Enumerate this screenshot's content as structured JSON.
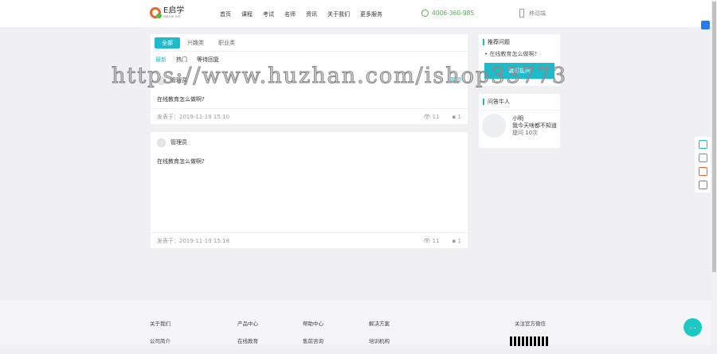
{
  "header": {
    "logo_text": "E启学",
    "logo_sub": "eqixue.net",
    "nav": [
      "首页",
      "课程",
      "考试",
      "名师",
      "资讯",
      "关于我们",
      "更多服务"
    ],
    "phone": "4006-360-985",
    "app": "移动端"
  },
  "tabs": {
    "categories": [
      "全部",
      "兴趣类",
      "职业类"
    ],
    "sorts": [
      "最新",
      "热门",
      "等待回复"
    ]
  },
  "posts": [
    {
      "author": "管理员",
      "tag": "置顶",
      "title": "在线教育怎么做啊?",
      "time": "发表于：2019-11-19 15:10",
      "views": "11",
      "comments": "1"
    },
    {
      "author": "管理员",
      "title": "在线教育怎么做啊?",
      "time": "发表于：2019-11-19 15:18",
      "views": "11",
      "comments": "1"
    }
  ],
  "sidebar": {
    "recommend_title": "推荐问题",
    "recommend_item": "在线教育怎么做啊?",
    "ask_button": "我要提问",
    "experts_title": "问答牛人",
    "expert_name": "小明",
    "expert_desc": "我今天啥都不知道",
    "expert_count": "提问 10次"
  },
  "footer": {
    "cols": [
      {
        "title": "关于我们",
        "item": "公司简介"
      },
      {
        "title": "产品中心",
        "item": "在线教育"
      },
      {
        "title": "帮助中心",
        "item": "售前咨询"
      },
      {
        "title": "解决方案",
        "item": "培训机构"
      }
    ],
    "wechat": "关注官方微信"
  },
  "watermark": "https://www.huzhan.com/ishop33773"
}
